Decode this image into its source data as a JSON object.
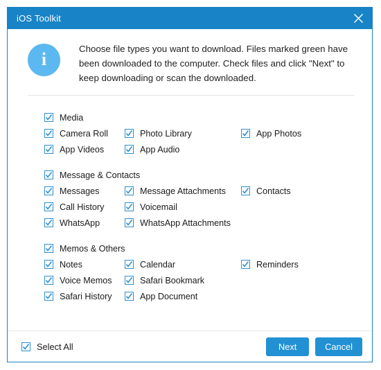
{
  "window": {
    "title": "iOS Toolkit",
    "close_icon": "close-icon",
    "accent_color": "#1884c7",
    "button_color": "#2291d4",
    "checkbox_color": "#2c8fd6"
  },
  "banner": {
    "icon": "info-icon",
    "icon_glyph": "i",
    "text": "Choose file types you want to download. Files marked green have been downloaded to the computer. Check files and click \"Next\" to keep downloading or scan the downloaded."
  },
  "groups": [
    {
      "header": "Media",
      "header_checked": true,
      "rows": [
        [
          {
            "label": "Camera Roll",
            "checked": true
          },
          {
            "label": "Photo Library",
            "checked": true
          },
          {
            "label": "App Photos",
            "checked": true
          }
        ],
        [
          {
            "label": "App Videos",
            "checked": true
          },
          {
            "label": "App Audio",
            "checked": true
          },
          {
            "label": "",
            "checked": false,
            "empty": true
          }
        ]
      ]
    },
    {
      "header": "Message & Contacts",
      "header_checked": true,
      "rows": [
        [
          {
            "label": "Messages",
            "checked": true
          },
          {
            "label": "Message Attachments",
            "checked": true
          },
          {
            "label": "Contacts",
            "checked": true
          }
        ],
        [
          {
            "label": "Call History",
            "checked": true
          },
          {
            "label": "Voicemail",
            "checked": true
          },
          {
            "label": "",
            "checked": false,
            "empty": true
          }
        ],
        [
          {
            "label": "WhatsApp",
            "checked": true
          },
          {
            "label": "WhatsApp Attachments",
            "checked": true
          },
          {
            "label": "",
            "checked": false,
            "empty": true
          }
        ]
      ]
    },
    {
      "header": "Memos & Others",
      "header_checked": true,
      "rows": [
        [
          {
            "label": "Notes",
            "checked": true
          },
          {
            "label": "Calendar",
            "checked": true
          },
          {
            "label": "Reminders",
            "checked": true
          }
        ],
        [
          {
            "label": "Voice Memos",
            "checked": true
          },
          {
            "label": "Safari Bookmark",
            "checked": true
          },
          {
            "label": "",
            "checked": false,
            "empty": true
          }
        ],
        [
          {
            "label": "Safari History",
            "checked": true
          },
          {
            "label": "App Document",
            "checked": true
          },
          {
            "label": "",
            "checked": false,
            "empty": true
          }
        ]
      ]
    }
  ],
  "footer": {
    "select_all_label": "Select All",
    "select_all_checked": true,
    "next_label": "Next",
    "cancel_label": "Cancel"
  }
}
